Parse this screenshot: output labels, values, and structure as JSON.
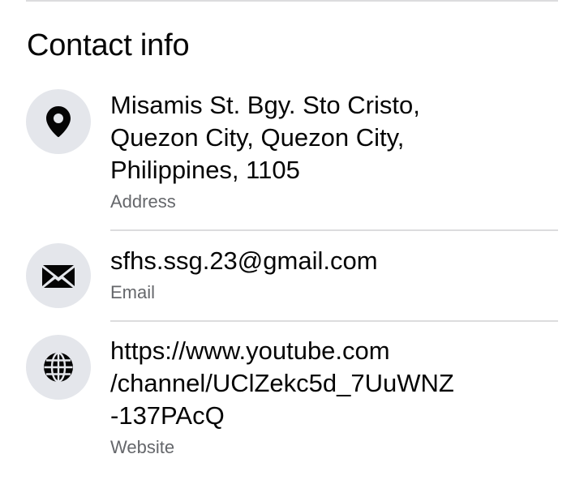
{
  "section": {
    "title": "Contact info"
  },
  "contacts": [
    {
      "icon": "location-pin-icon",
      "value_lines": [
        "Misamis St. Bgy. Sto Cristo,",
        "Quezon City, Quezon City,",
        "Philippines, 1105"
      ],
      "label": "Address"
    },
    {
      "icon": "envelope-icon",
      "value_lines": [
        "sfhs.ssg.23@gmail.com"
      ],
      "label": "Email"
    },
    {
      "icon": "globe-icon",
      "value_lines": [
        "https://www.youtube.com",
        "/channel/UClZekc5d_7UuWNZ",
        "-137PAcQ"
      ],
      "label": "Website"
    }
  ],
  "colors": {
    "text_primary": "#050505",
    "text_secondary": "#65676b",
    "icon_bg": "#e4e6eb",
    "divider": "#dcdcde"
  }
}
